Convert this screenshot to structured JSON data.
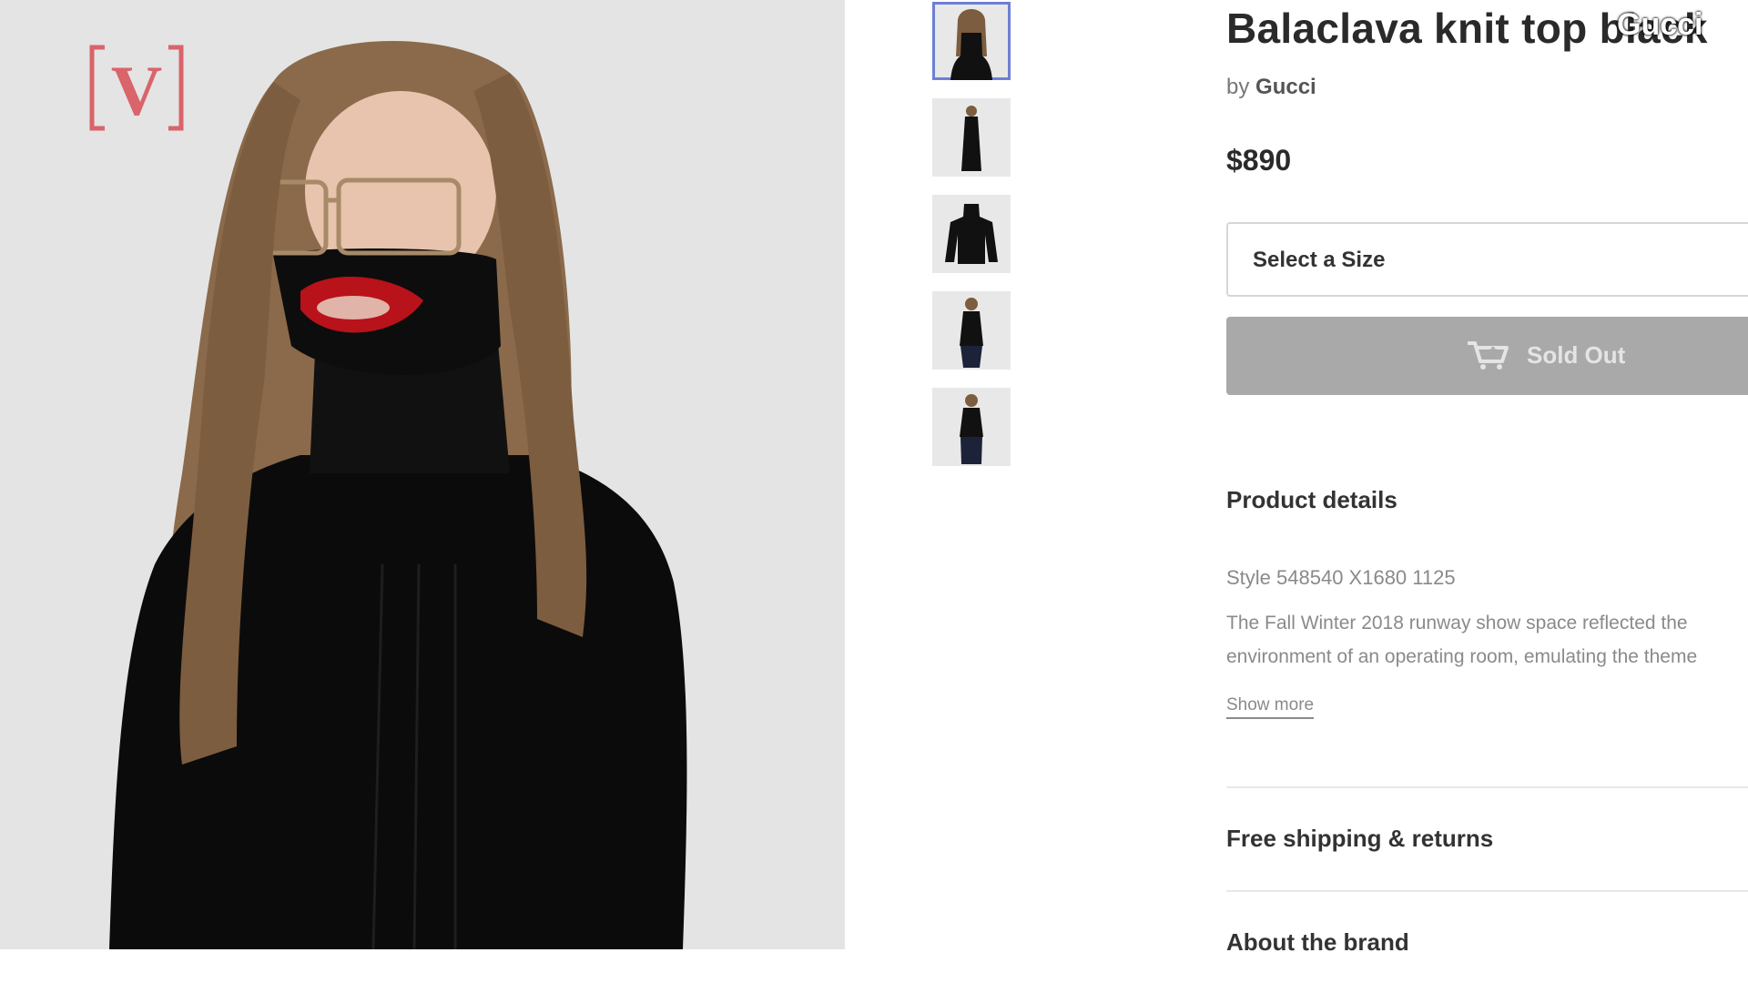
{
  "product": {
    "title": "Balaclava knit top black",
    "by_prefix": "by",
    "brand": "Gucci",
    "price": "$890"
  },
  "watermark": "Gucci",
  "logo_letter": "V",
  "size_select": {
    "label": "Select a Size"
  },
  "buy_button": {
    "label": "Sold Out",
    "icon": "cart-icon"
  },
  "details": {
    "heading": "Product details",
    "style": "Style 548540 X1680 1125",
    "line1": "The Fall Winter 2018 runway show space reflected the",
    "line2": "environment of an operating room, emulating the theme",
    "show_more": "Show more"
  },
  "sections": {
    "shipping": "Free shipping & returns",
    "about": "About the brand"
  },
  "thumbnails": [
    "thumb-front-face",
    "thumb-full-length",
    "thumb-sweater-flat",
    "thumb-model-front",
    "thumb-model-back"
  ],
  "colors": {
    "accent": "#6d7fd6",
    "sold_out_bg": "#a9a9a9",
    "logo": "#d9646a"
  }
}
